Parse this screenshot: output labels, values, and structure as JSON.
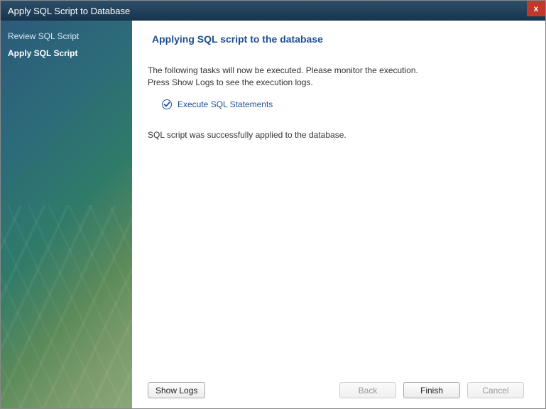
{
  "window": {
    "title": "Apply SQL Script to Database"
  },
  "sidebar": {
    "steps": [
      {
        "label": "Review SQL Script",
        "active": false
      },
      {
        "label": "Apply SQL Script",
        "active": true
      }
    ]
  },
  "main": {
    "heading": "Applying SQL script to the database",
    "info_line1": "The following tasks will now be executed. Please monitor the execution.",
    "info_line2": "Press Show Logs to see the execution logs.",
    "task_label": "Execute SQL Statements",
    "status": "SQL script was successfully applied to the database."
  },
  "footer": {
    "show_logs": "Show Logs",
    "back": "Back",
    "finish": "Finish",
    "cancel": "Cancel",
    "back_enabled": false,
    "cancel_enabled": false
  },
  "icons": {
    "close": "x",
    "task_check": "check-icon"
  }
}
